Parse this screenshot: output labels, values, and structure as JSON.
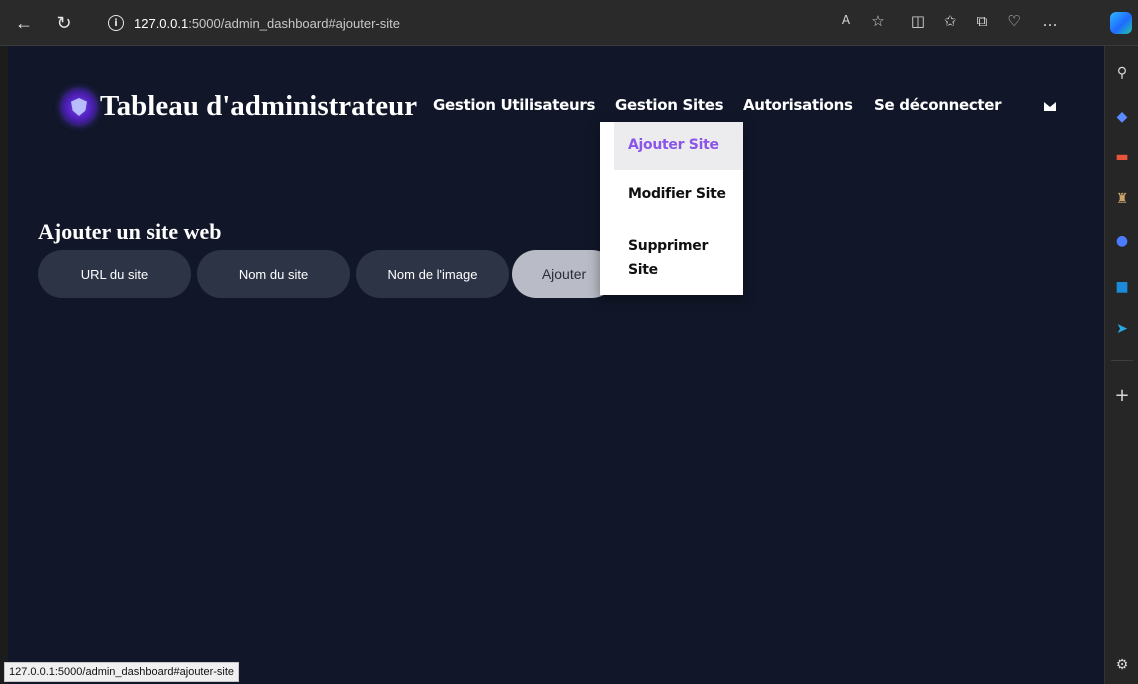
{
  "browser": {
    "url_host": "127.0.0.1",
    "url_rest": ":5000/admin_dashboard#ajouter-site",
    "status_url": "127.0.0.1:5000/admin_dashboard#ajouter-site"
  },
  "header": {
    "title": "Tableau d'administrateur",
    "nav": [
      {
        "label": "Gestion Utilisateurs"
      },
      {
        "label": "Gestion Sites"
      },
      {
        "label": "Autorisations"
      },
      {
        "label": "Se déconnecter"
      }
    ]
  },
  "dropdown": {
    "items": [
      {
        "label": "Ajouter Site",
        "active": true
      },
      {
        "label": "Modifier Site"
      },
      {
        "label": "Supprimer Site"
      }
    ]
  },
  "form": {
    "title": "Ajouter un site web",
    "url_placeholder": "URL du site",
    "name_placeholder": "Nom du site",
    "image_placeholder": "Nom de l'image",
    "submit_label": "Ajouter"
  },
  "colors": {
    "page_bg": "#111729",
    "field_bg": "#2d3446",
    "accent": "#8b55e8"
  }
}
